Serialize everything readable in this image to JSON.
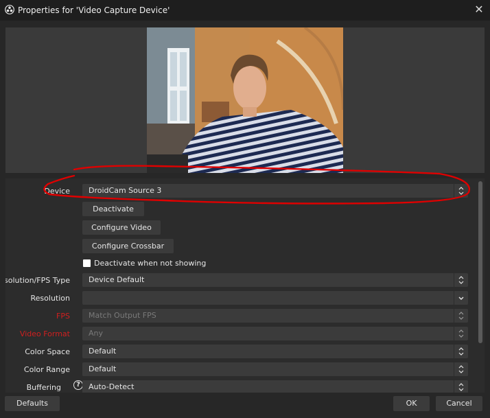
{
  "window": {
    "title": "Properties for 'Video Capture Device'",
    "close_glyph": "✕",
    "app_icon": "obs-logo-icon"
  },
  "colors": {
    "background": "#272727",
    "panel": "#2c2c2c",
    "field": "#3b3b3b",
    "highlight_red": "#d11f1f",
    "annotation_red": "#e00000"
  },
  "properties": {
    "device": {
      "label": "Device",
      "value": "DroidCam Source 3"
    },
    "deactivate_button": "Deactivate",
    "configure_video_button": "Configure Video",
    "configure_crossbar_button": "Configure Crossbar",
    "deactivate_when_not_showing": {
      "label": "Deactivate when not showing",
      "checked": false
    },
    "resolution_fps_type": {
      "label": "Resolution/FPS Type",
      "value": "Device Default"
    },
    "resolution": {
      "label": "Resolution",
      "value": ""
    },
    "fps": {
      "label": "FPS",
      "value": "Match Output FPS"
    },
    "video_format": {
      "label": "Video Format",
      "value": "Any"
    },
    "color_space": {
      "label": "Color Space",
      "value": "Default"
    },
    "color_range": {
      "label": "Color Range",
      "value": "Default"
    },
    "buffering": {
      "label": "Buffering",
      "value": "Auto-Detect",
      "help_glyph": "?"
    }
  },
  "footer": {
    "defaults_button": "Defaults",
    "ok_button": "OK",
    "cancel_button": "Cancel"
  }
}
